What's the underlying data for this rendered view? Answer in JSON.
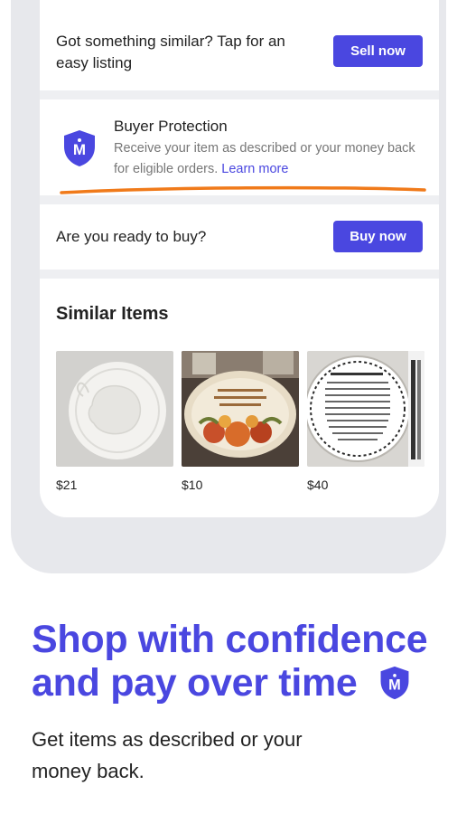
{
  "sell_section": {
    "prompt": "Got something similar? Tap for an easy listing",
    "button_label": "Sell now"
  },
  "buyer_protection": {
    "title": "Buyer Protection",
    "description": "Receive your item as described or your money back for eligible orders.",
    "link_label": "Learn more",
    "icon": "shield-m-icon"
  },
  "buy_section": {
    "prompt": "Are you ready to buy?",
    "button_label": "Buy now"
  },
  "similar_items": {
    "title": "Similar Items",
    "items": [
      {
        "price": "$21",
        "image": "white turkey plate"
      },
      {
        "price": "$10",
        "image": "autumn pumpkin platter"
      },
      {
        "price": "$40",
        "image": "the sharing plate"
      }
    ]
  },
  "promo": {
    "headline": "Shop with confidence and pay over time",
    "subline": "Get items as described or your money back."
  },
  "colors": {
    "brand": "#4a47e0",
    "highlight": "#f07a1a"
  }
}
